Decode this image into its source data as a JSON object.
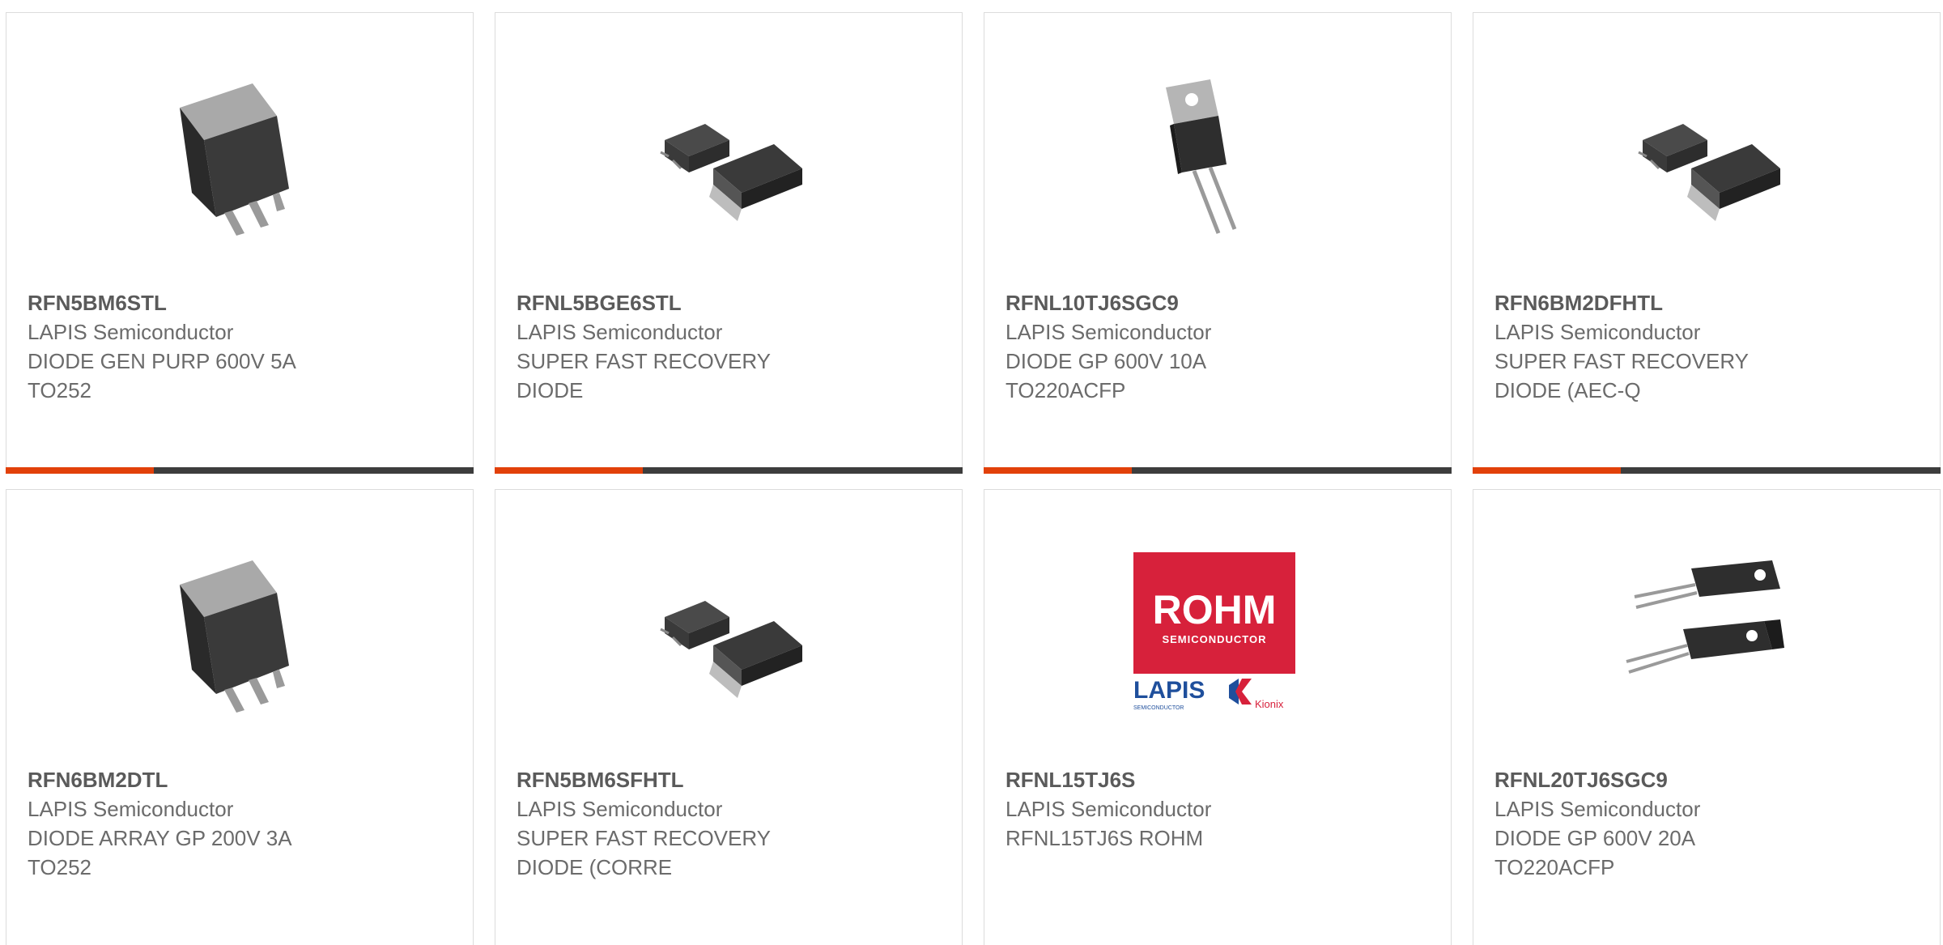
{
  "products": [
    {
      "part": "RFN5BM6STL",
      "maker": "LAPIS Semiconductor",
      "desc1": "DIODE GEN PURP 600V 5A",
      "desc2": "TO252",
      "image": "dpak-package-image"
    },
    {
      "part": "RFNL5BGE6STL",
      "maker": "LAPIS Semiconductor",
      "desc1": "SUPER FAST RECOVERY",
      "desc2": "DIODE",
      "image": "dpak-pair-package-image"
    },
    {
      "part": "RFNL10TJ6SGC9",
      "maker": "LAPIS Semiconductor",
      "desc1": "DIODE GP 600V 10A",
      "desc2": "TO220ACFP",
      "image": "to220-package-image"
    },
    {
      "part": "RFN6BM2DFHTL",
      "maker": "LAPIS Semiconductor",
      "desc1": "SUPER FAST RECOVERY",
      "desc2": "DIODE (AEC-Q",
      "image": "dpak-pair-package-image"
    },
    {
      "part": "RFN6BM2DTL",
      "maker": "LAPIS Semiconductor",
      "desc1": "DIODE ARRAY GP 200V 3A",
      "desc2": "TO252",
      "image": "dpak-package-image"
    },
    {
      "part": "RFN5BM6SFHTL",
      "maker": "LAPIS Semiconductor",
      "desc1": "SUPER FAST RECOVERY",
      "desc2": "DIODE (CORRE",
      "image": "dpak-pair-package-image"
    },
    {
      "part": "RFNL15TJ6S",
      "maker": "LAPIS Semiconductor",
      "desc1": "RFNL15TJ6S ROHM",
      "desc2": "",
      "image": "rohm-logo-image"
    },
    {
      "part": "RFNL20TJ6SGC9",
      "maker": "LAPIS Semiconductor",
      "desc1": "DIODE GP 600V 20A",
      "desc2": "TO220ACFP",
      "image": "to220fp-pair-package-image"
    }
  ],
  "logo": {
    "brand": "ROHM",
    "tagline": "SEMICONDUCTOR",
    "sub_brand": "LAPIS",
    "sub_tagline": "SEMICONDUCTOR",
    "partner": "Kionix"
  },
  "colors": {
    "accent": "#e2410a",
    "bar": "#3d3d3d",
    "rohm_red": "#d7213b",
    "lapis_blue": "#1f4f9c"
  }
}
